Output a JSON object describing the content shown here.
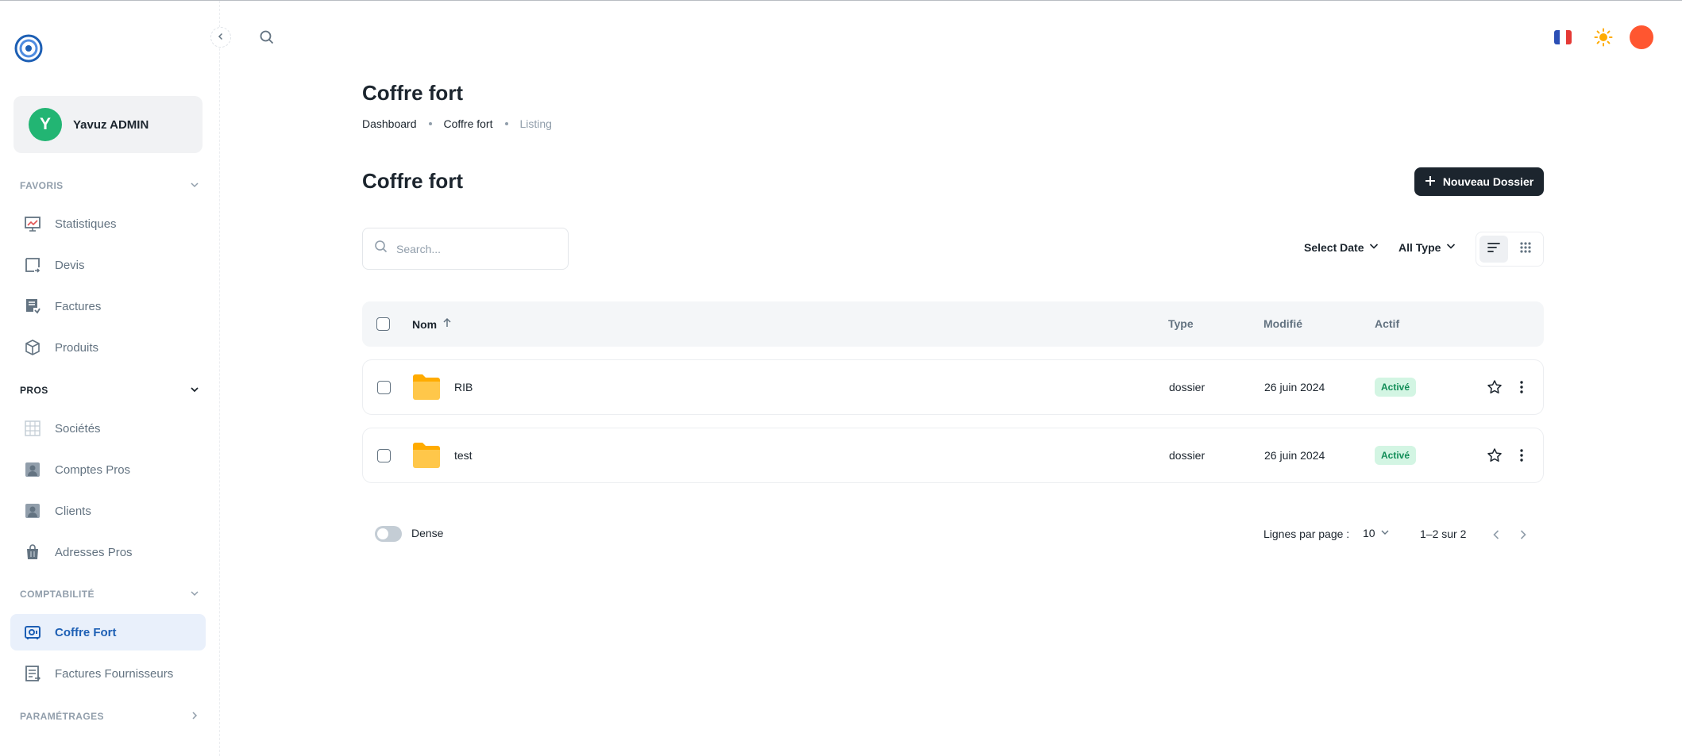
{
  "user": {
    "initial": "Y",
    "name": "Yavuz ADMIN"
  },
  "sidebar": {
    "sections": {
      "favoris": "FAVORIS",
      "pros": "PROS",
      "comptabilite": "COMPTABILITÉ",
      "parametrages": "PARAMÉTRAGES"
    },
    "items": {
      "statistiques": "Statistiques",
      "devis": "Devis",
      "factures": "Factures",
      "produits": "Produits",
      "societes": "Sociétés",
      "comptes_pros": "Comptes Pros",
      "clients": "Clients",
      "adresses_pros": "Adresses Pros",
      "coffre_fort": "Coffre Fort",
      "factures_fournisseurs": "Factures Fournisseurs"
    }
  },
  "header": {
    "language_icon": "flag-fr-icon",
    "theme_icon": "sun-icon",
    "avatar_color": "#ff5630"
  },
  "page": {
    "title": "Coffre fort",
    "breadcrumbs": [
      "Dashboard",
      "Coffre fort",
      "Listing"
    ],
    "section_title": "Coffre fort",
    "new_button": "Nouveau Dossier"
  },
  "filters": {
    "search_placeholder": "Search...",
    "date": "Select Date",
    "type": "All Type"
  },
  "table": {
    "headers": {
      "name": "Nom",
      "type": "Type",
      "modified": "Modifié",
      "active": "Actif"
    },
    "rows": [
      {
        "name": "RIB",
        "type": "dossier",
        "modified": "26 juin 2024",
        "status": "Activé"
      },
      {
        "name": "test",
        "type": "dossier",
        "modified": "26 juin 2024",
        "status": "Activé"
      }
    ]
  },
  "footer": {
    "dense_label": "Dense",
    "rows_per_page_label": "Lignes par page :",
    "rows_per_page": "10",
    "range": "1–2 sur 2"
  },
  "colors": {
    "primary": "#1c252e",
    "accent": "#1d5fb4",
    "success_bg": "#d3f5e3",
    "success_text": "#118d57"
  }
}
